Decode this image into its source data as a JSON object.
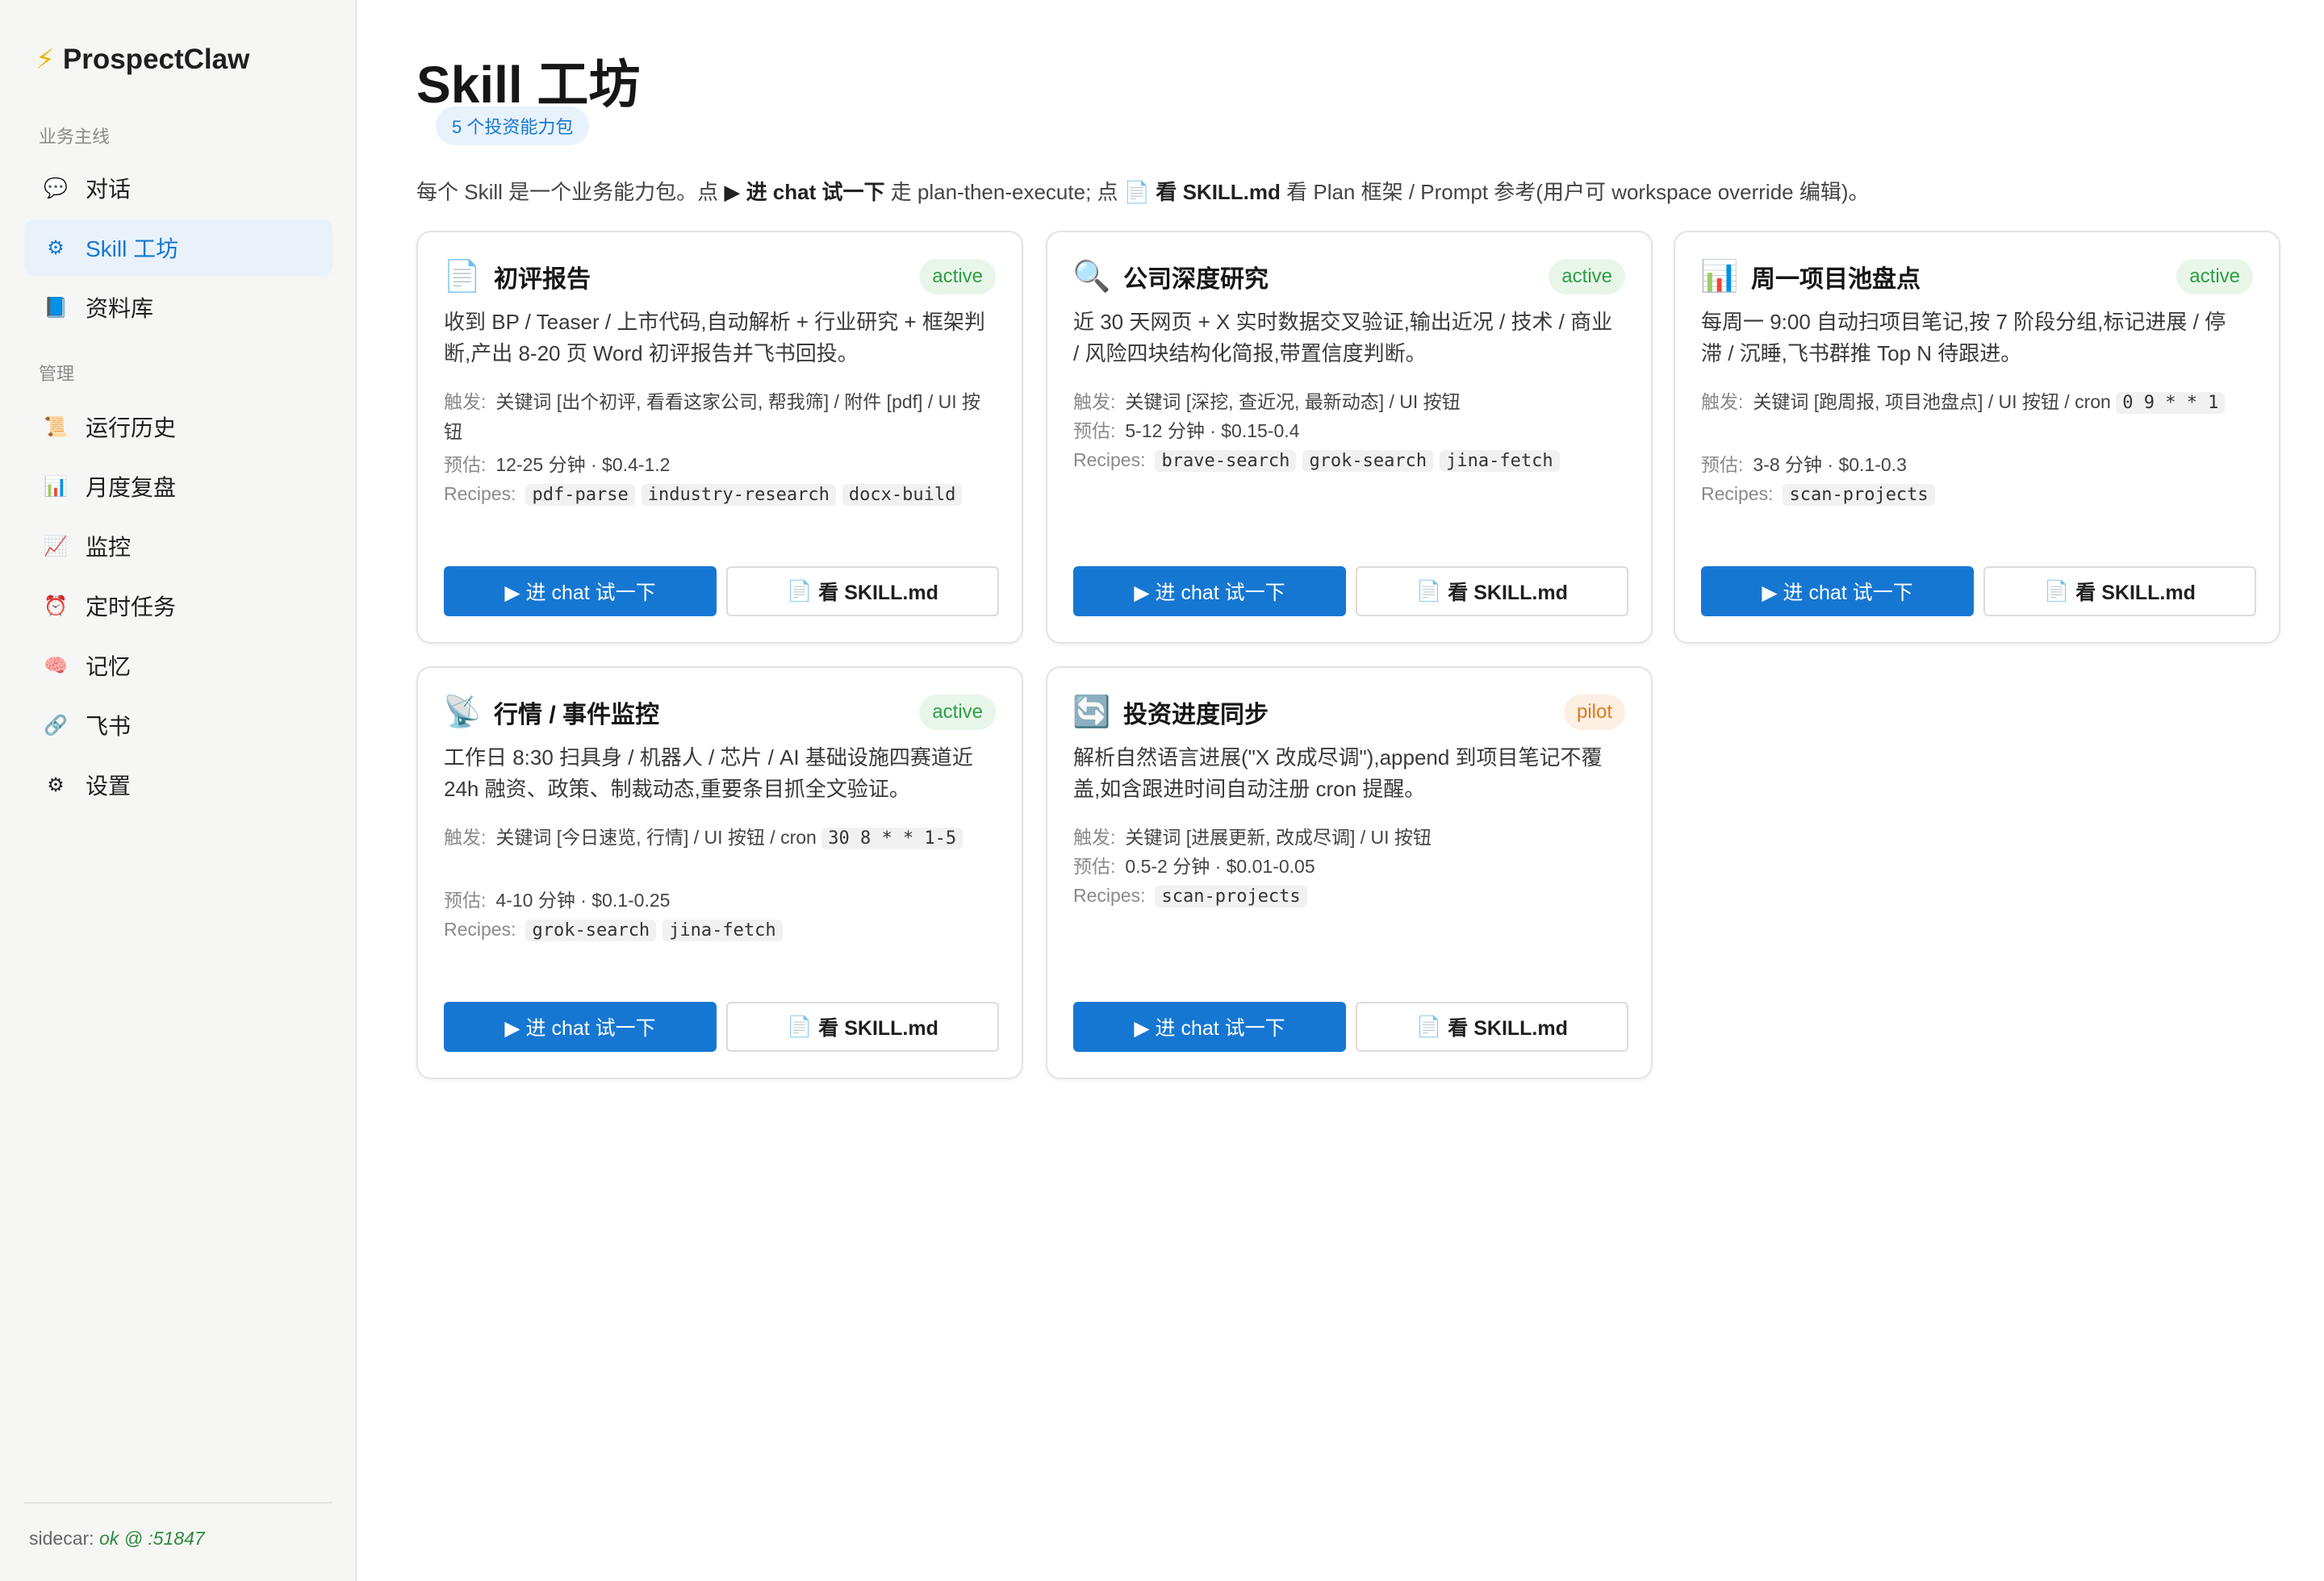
{
  "app": {
    "name": "ProspectClaw"
  },
  "sidebar": {
    "section_main": "业务主线",
    "section_manage": "管理",
    "items": [
      {
        "icon": "speech-bubble-icon",
        "glyph": "💬",
        "label": "对话"
      },
      {
        "icon": "gear-icon",
        "glyph": "⚙",
        "label": "Skill 工坊"
      },
      {
        "icon": "book-icon",
        "glyph": "📘",
        "label": "资料库"
      },
      {
        "icon": "scroll-icon",
        "glyph": "📜",
        "label": "运行历史"
      },
      {
        "icon": "bar-chart-icon",
        "glyph": "📊",
        "label": "月度复盘"
      },
      {
        "icon": "trend-chart-icon",
        "glyph": "📈",
        "label": "监控"
      },
      {
        "icon": "alarm-clock-icon",
        "glyph": "⏰",
        "label": "定时任务"
      },
      {
        "icon": "brain-icon",
        "glyph": "🧠",
        "label": "记忆"
      },
      {
        "icon": "link-icon",
        "glyph": "🔗",
        "label": "飞书"
      },
      {
        "icon": "gear-icon",
        "glyph": "⚙",
        "label": "设置"
      }
    ],
    "footer_label": "sidecar: ",
    "footer_status": "ok @ :51847"
  },
  "page": {
    "title": "Skill 工坊",
    "count_badge": "5 个投资能力包",
    "intro_1": "每个 Skill 是一个业务能力包。点 ",
    "intro_chat": "▶ 进 chat 试一下",
    "intro_2": " 走 plan-then-execute; 点 ",
    "intro_skill": "📄 看 SKILL.md",
    "intro_3": " 看 Plan 框架 / Prompt 参考(用户可 workspace override 编辑)。"
  },
  "labels": {
    "trigger": "触发:",
    "estimate": "预估:",
    "recipes": "Recipes:",
    "try_chat": "▶ 进 chat 试一下",
    "view_skill": "看 SKILL.md"
  },
  "colors": {
    "accent": "#1677d2",
    "active": "#2e9e45",
    "pilot": "#d97b1e"
  },
  "cards": [
    {
      "icon": "document-icon",
      "glyph": "📄",
      "title": "初评报告",
      "status": "active",
      "desc": "收到 BP / Teaser / 上市代码,自动解析 + 行业研究 + 框架判断,产出 8-20 页 Word 初评报告并飞书回投。",
      "trigger": "关键词 [出个初评, 看看这家公司, 帮我筛] / 附件 [pdf] / UI 按钮",
      "trigger_code": "",
      "estimate": "12-25 分钟 · $0.4-1.2",
      "recipes": [
        "pdf-parse",
        "industry-research",
        "docx-build"
      ]
    },
    {
      "icon": "magnifier-icon",
      "glyph": "🔍",
      "title": "公司深度研究",
      "status": "active",
      "desc": "近 30 天网页 + X 实时数据交叉验证,输出近况 / 技术 / 商业 / 风险四块结构化简报,带置信度判断。",
      "trigger": "关键词 [深挖, 查近况, 最新动态] / UI 按钮",
      "trigger_code": "",
      "estimate": "5-12 分钟 · $0.15-0.4",
      "recipes": [
        "brave-search",
        "grok-search",
        "jina-fetch"
      ]
    },
    {
      "icon": "bar-chart-icon",
      "glyph": "📊",
      "title": "周一项目池盘点",
      "status": "active",
      "desc": "每周一 9:00 自动扫项目笔记,按 7 阶段分组,标记进展 / 停滞 / 沉睡,飞书群推 Top N 待跟进。",
      "trigger": "关键词 [跑周报, 项目池盘点] / UI 按钮 / cron ",
      "trigger_code": "0 9 * * 1",
      "estimate": "3-8 分钟 · $0.1-0.3",
      "recipes": [
        "scan-projects"
      ]
    },
    {
      "icon": "satellite-icon",
      "glyph": "📡",
      "title": "行情 / 事件监控",
      "status": "active",
      "desc": "工作日 8:30 扫具身 / 机器人 / 芯片 / AI 基础设施四赛道近 24h 融资、政策、制裁动态,重要条目抓全文验证。",
      "trigger": "关键词 [今日速览, 行情] / UI 按钮 / cron ",
      "trigger_code": "30 8 * * 1-5",
      "estimate": "4-10 分钟 · $0.1-0.25",
      "recipes": [
        "grok-search",
        "jina-fetch"
      ]
    },
    {
      "icon": "sync-icon",
      "glyph": "🔄",
      "title": "投资进度同步",
      "status": "pilot",
      "desc": "解析自然语言进展(\"X 改成尽调\"),append 到项目笔记不覆盖,如含跟进时间自动注册 cron 提醒。",
      "trigger": "关键词 [进展更新, 改成尽调] / UI 按钮",
      "trigger_code": "",
      "estimate": "0.5-2 分钟 · $0.01-0.05",
      "recipes": [
        "scan-projects"
      ]
    }
  ]
}
